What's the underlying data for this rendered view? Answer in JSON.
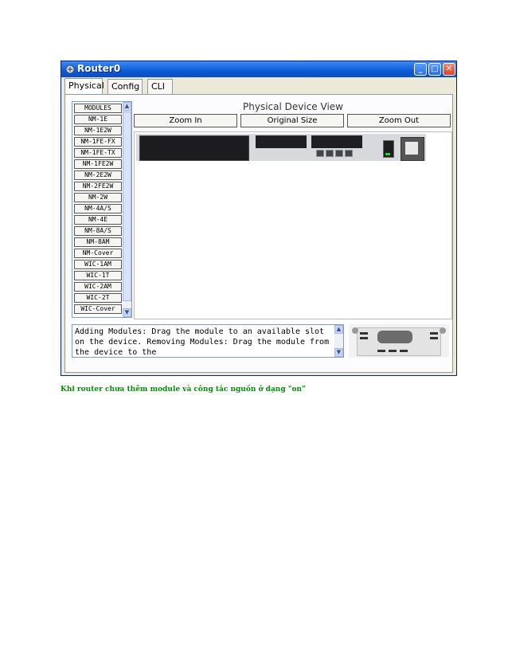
{
  "window": {
    "title": "Router0",
    "tabs": [
      {
        "label": "Physical",
        "active": true
      },
      {
        "label": "Config",
        "active": false
      },
      {
        "label": "CLI",
        "active": false
      }
    ]
  },
  "modules": {
    "items": [
      "MODULES",
      "NM-1E",
      "NM-1E2W",
      "NM-1FE-FX",
      "NM-1FE-TX",
      "NM-1FE2W",
      "NM-2E2W",
      "NM-2FE2W",
      "NM-2W",
      "NM-4A/S",
      "NM-4E",
      "NM-8A/S",
      "NM-8AM",
      "NM-Cover",
      "WIC-1AM",
      "WIC-1T",
      "WIC-2AM",
      "WIC-2T",
      "WIC-Cover"
    ]
  },
  "device_view": {
    "title": "Physical Device View",
    "zoom_in": "Zoom In",
    "original_size": "Original Size",
    "zoom_out": "Zoom Out"
  },
  "help": {
    "text": "Adding Modules: Drag the module to an available slot on the device. Removing Modules: Drag the module from the device to the"
  },
  "caption": "Khi router chưa thêm module và công tắc nguồn ở dạng \"on\"",
  "colors": {
    "titlebar": "#0a5bd6",
    "caption": "#0a8a0a"
  }
}
